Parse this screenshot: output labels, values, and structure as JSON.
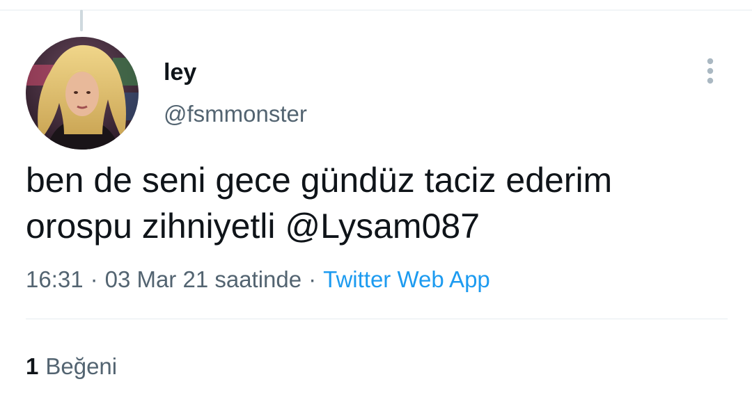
{
  "tweet": {
    "author": {
      "display_name": "ley",
      "handle": "@fsmmonster",
      "avatar_icon": "profile-photo"
    },
    "text": "ben de seni gece gündüz taciz ederim\norospu zihniyetli @Lysam087",
    "time": "16:31",
    "date": "03 Mar 21 saatinde",
    "separator": "·",
    "source": "Twitter Web App",
    "likes": {
      "count": "1",
      "label": "Beğeni"
    },
    "more_icon": "more-vertical-icon"
  },
  "colors": {
    "text_primary": "#0f1419",
    "text_secondary": "#536471",
    "link": "#1d9bf0",
    "divider": "#e6ecf0"
  }
}
